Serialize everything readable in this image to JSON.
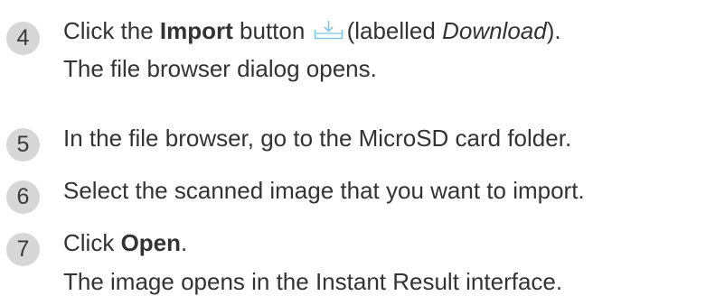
{
  "steps": [
    {
      "number": "4",
      "line1": {
        "pre": "Click the ",
        "bold": "Import",
        "mid": " button",
        "icon": "download-tray-icon",
        "paren_open": "(labelled ",
        "italic": "Download",
        "paren_close": ")."
      },
      "line2": "The file browser dialog opens."
    },
    {
      "number": "5",
      "text": "In the file browser, go to the MicroSD card folder."
    },
    {
      "number": "6",
      "text": "Select the scanned image that you want to import."
    },
    {
      "number": "7",
      "line1": {
        "pre": "Click ",
        "bold": "Open",
        "post": "."
      },
      "line2": "The image opens in the Instant Result interface."
    }
  ],
  "colors": {
    "text": "#333333",
    "badge_bg": "#d7d7d7",
    "icon_accent": "#7fc6e6"
  }
}
